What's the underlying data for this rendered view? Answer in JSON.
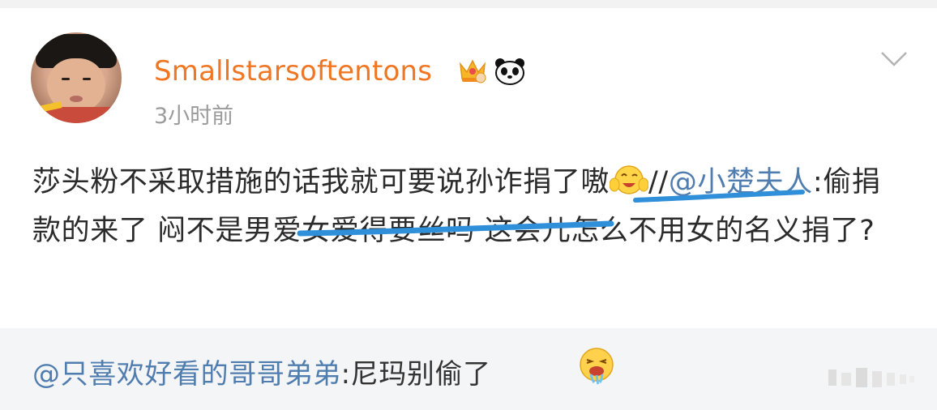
{
  "post": {
    "username": "Smallstarsoftentons",
    "timestamp": "3小时前",
    "text_part1": "莎头粉不采取措施的话我就可要说孙诈捐了嗷",
    "sep": "//",
    "mention": "@小楚夫人",
    "text_part2": ":偷捐款的来了 闷不是男爱女爱得要丝吗 这会儿怎么不用女的名义捐了?"
  },
  "repost": {
    "mention": "@只喜欢好看的哥哥弟弟",
    "text": ":尼玛别偷了"
  },
  "colors": {
    "username": "#ef7623",
    "mention": "#507daf",
    "timestamp": "#9b9b9b",
    "body_text": "#2b2b2b",
    "repost_bg": "#f4f5f7",
    "annotation_stroke": "#2f8fd8"
  },
  "icons": {
    "avatar": "user-avatar-photo",
    "crown": "vip-crown-badge",
    "panda": "panda-badge",
    "chevron": "chevron-down-icon",
    "inline_emoji": "grinning-wink-hands-emoji",
    "repost_emoji": "drooling-face-emoji",
    "watermark": "weibo-watermark-icon"
  }
}
